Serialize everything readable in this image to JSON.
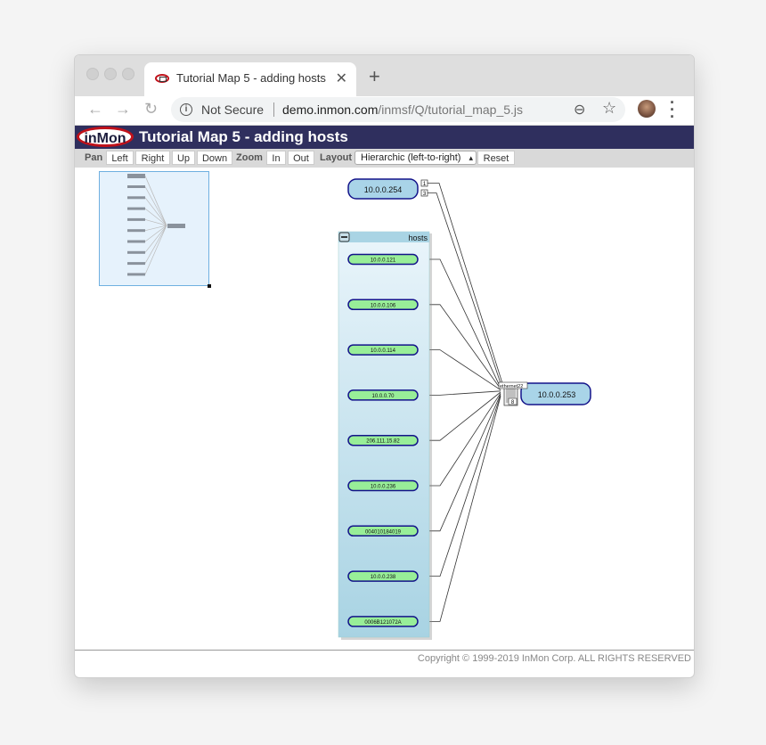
{
  "browser": {
    "tab_title": "Tutorial Map 5 - adding hosts",
    "security_label": "Not Secure",
    "url_host": "demo.inmon.com",
    "url_path": "/inmsf/Q/tutorial_map_5.js",
    "icons": {
      "back": "←",
      "forward": "→",
      "reload": "↻",
      "info": "i",
      "zoom": "⊖",
      "star": "☆",
      "close": "✕",
      "new_tab": "+",
      "menu": "⋮"
    }
  },
  "app": {
    "logo_text": "inMon",
    "title": "Tutorial Map 5 - adding hosts",
    "brand_color": "#2f2f5e",
    "logo_ring_color": "#c0111a"
  },
  "toolbar": {
    "pan_label": "Pan",
    "left": "Left",
    "right": "Right",
    "up": "Up",
    "down": "Down",
    "zoom_label": "Zoom",
    "zoom_in": "In",
    "zoom_out": "Out",
    "layout_label": "Layout",
    "layout_selected": "Hierarchic (left-to-right)",
    "reset": "Reset"
  },
  "map": {
    "router_node": {
      "label": "10.0.0.254",
      "ports": [
        "1",
        "3"
      ]
    },
    "switch_node": {
      "label": "10.0.0.253",
      "port_labels": [
        "ethernet22",
        "8"
      ]
    },
    "group": {
      "title": "hosts",
      "collapse_icon": "−",
      "hosts": [
        "10.0.0.121",
        "10.0.0.106",
        "10.0.0.114",
        "10.0.0.70",
        "206.111.15.82",
        "10.0.0.236",
        "004010184019",
        "10.0.0.238",
        "0006B121072A"
      ]
    },
    "colors": {
      "node_fill": "#a9d4e8",
      "node_stroke": "#13138a",
      "host_fill": "#98ee98",
      "group_fill_top": "#e8f3fa",
      "group_fill_bottom": "#a8d4e4",
      "group_header": "#a9d4e4"
    }
  },
  "footer": {
    "copyright": "Copyright © 1999-2019 InMon Corp. ALL RIGHTS RESERVED"
  }
}
